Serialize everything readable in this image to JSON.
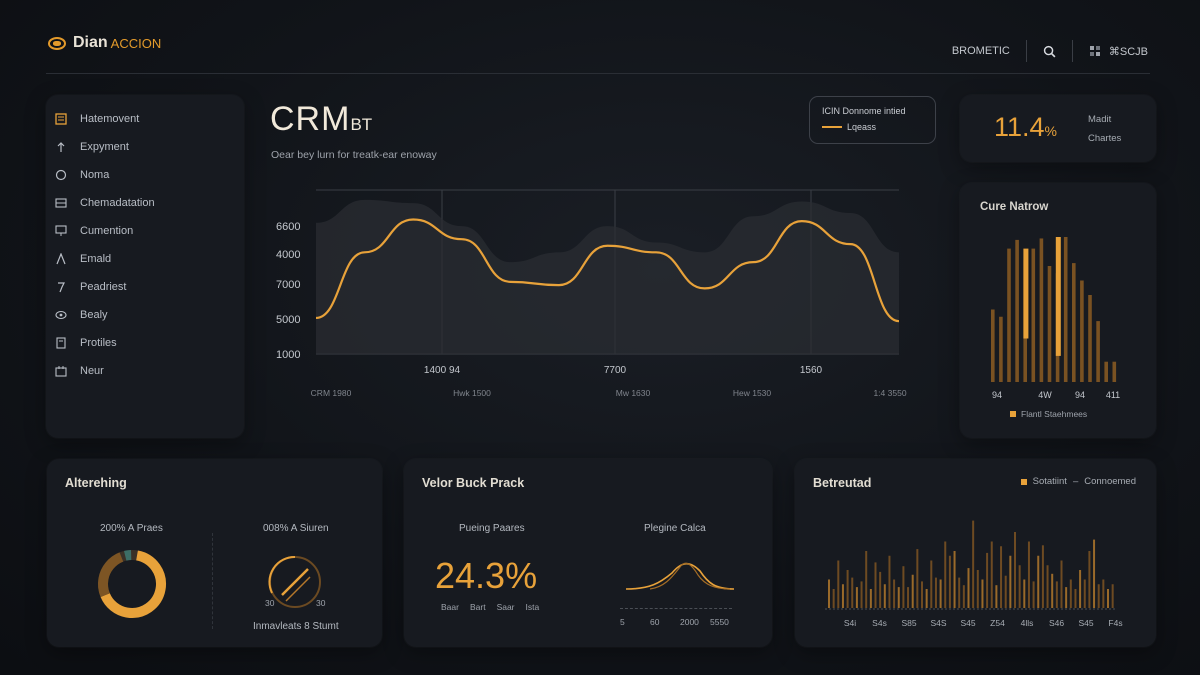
{
  "header": {
    "brand_name": "Dian",
    "brand_sub": "ACCION",
    "menu_label": "BROMETIC",
    "user_label": "⌘SCJB"
  },
  "sidebar": {
    "items": [
      {
        "label": "Hatemovent",
        "icon": "list-icon"
      },
      {
        "label": "Expyment",
        "icon": "arrow-up-icon"
      },
      {
        "label": "Noma",
        "icon": "circle-icon"
      },
      {
        "label": "Chemadatation",
        "icon": "grid-icon"
      },
      {
        "label": "Cumention",
        "icon": "board-icon"
      },
      {
        "label": "Emald",
        "icon": "triangle-icon"
      },
      {
        "label": "Peadriest",
        "icon": "pin-icon"
      },
      {
        "label": "Bealy",
        "icon": "eye-icon"
      },
      {
        "label": "Protiles",
        "icon": "document-icon"
      },
      {
        "label": "Neur",
        "icon": "calendar-icon"
      }
    ]
  },
  "main": {
    "title": "CRM",
    "title_suffix": "BT",
    "subtitle": "Oear bey lurn for treatk-ear enoway",
    "legend_title": "ICIN Donnome intied",
    "legend_series": "Lqeass"
  },
  "kpi": {
    "value": "11.4",
    "unit": "%",
    "label_line1": "Madit",
    "label_line2": "Chartes"
  },
  "histogram": {
    "title": "Cure Natrow",
    "legend": "Flantl Staehmees"
  },
  "cards": {
    "c1": {
      "title": "Alterehing",
      "left_label": "200% A Praes",
      "right_label": "008% A Siuren",
      "gauge_min": "30",
      "gauge_max": "30",
      "right_caption": "Inmavleats 8 Stumt"
    },
    "c2": {
      "title": "Velor Buck Prack",
      "left_label": "Pueing Paares",
      "big_value": "24.3%",
      "sub_labels": [
        "Baar",
        "Bart",
        "Saar",
        "Ista"
      ],
      "right_label": "Plegine Calca",
      "axis_ticks": [
        "5",
        "60",
        "2000",
        "5550"
      ]
    },
    "c3": {
      "title": "Betreutad",
      "legend_a": "Sotatiint",
      "legend_sep": "–",
      "legend_b": "Connoemed",
      "axis_ticks": [
        "S4i",
        "S4s",
        "S85",
        "S4S",
        "S45",
        "Z54",
        "4lls",
        "S46",
        "S45",
        "F4s"
      ]
    }
  },
  "chart_data": [
    {
      "type": "line",
      "title": "CRM BT",
      "y_tick_labels": [
        "6600",
        "4000",
        "7000",
        "5000",
        "1000"
      ],
      "x_tick_labels": [
        "1400 94",
        "7700",
        "1560"
      ],
      "x_axis_captions": [
        "CRM 1980",
        "Hwk 1500",
        "Mw 1630",
        "Hew 1530",
        "1:4 3550"
      ],
      "legend": [
        "Lqeass"
      ],
      "series": [
        {
          "name": "Lqeass",
          "shape": [
            0.22,
            0.62,
            0.82,
            0.7,
            0.44,
            0.42,
            0.66,
            0.62,
            0.4,
            0.56,
            0.81,
            0.67,
            0.2
          ],
          "color": "#e8a23a"
        },
        {
          "name": "area",
          "shape": [
            0.8,
            0.94,
            0.92,
            0.78,
            0.56,
            0.62,
            0.78,
            0.68,
            0.62,
            0.84,
            0.93,
            0.86,
            0.62
          ],
          "color": "#2b2e33"
        }
      ]
    },
    {
      "type": "bar",
      "title": "Cure Natrow",
      "x_tick_labels": [
        "94",
        "4W",
        "94",
        "411"
      ],
      "series": [
        {
          "name": "Flantl Staehmees",
          "values": [
            0.5,
            0.45,
            0.92,
            0.98,
            0.84,
            0.92,
            0.99,
            0.8,
            0.75,
            1.0,
            0.82,
            0.7,
            0.6,
            0.42,
            0.14,
            0.14
          ]
        }
      ]
    },
    {
      "type": "bar",
      "title": "Betreutad",
      "series": [
        {
          "name": "Sotatiint",
          "values": [
            0.3,
            0.2,
            0.5,
            0.25,
            0.4,
            0.32,
            0.22,
            0.28,
            0.6,
            0.2,
            0.48,
            0.38,
            0.25,
            0.55,
            0.3,
            0.22,
            0.44,
            0.22,
            0.35,
            0.62,
            0.28,
            0.2,
            0.5,
            0.32,
            0.3,
            0.7,
            0.55,
            0.6,
            0.32,
            0.24,
            0.42,
            0.92,
            0.4,
            0.3,
            0.58,
            0.7,
            0.24,
            0.65,
            0.34,
            0.55,
            0.8,
            0.45,
            0.3,
            0.7,
            0.28,
            0.55,
            0.66,
            0.45,
            0.36,
            0.28,
            0.5,
            0.22,
            0.3,
            0.2,
            0.4,
            0.3,
            0.6,
            0.72,
            0.25,
            0.3,
            0.2,
            0.25
          ]
        }
      ]
    }
  ]
}
